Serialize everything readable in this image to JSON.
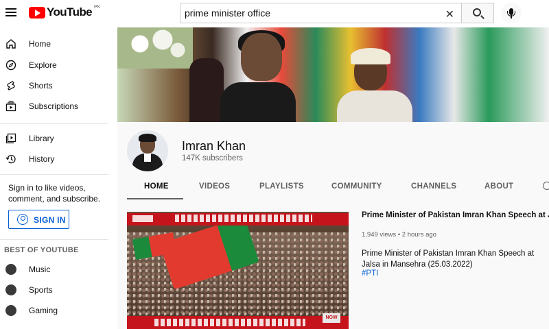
{
  "header": {
    "logo_text": "YouTube",
    "country_code": "PK",
    "search_value": "prime minister office",
    "search_placeholder": "Search"
  },
  "sidebar": {
    "items": [
      {
        "label": "Home",
        "icon": "home-icon"
      },
      {
        "label": "Explore",
        "icon": "compass-icon"
      },
      {
        "label": "Shorts",
        "icon": "shorts-icon"
      },
      {
        "label": "Subscriptions",
        "icon": "subscriptions-icon"
      },
      {
        "label": "Library",
        "icon": "library-icon"
      },
      {
        "label": "History",
        "icon": "history-icon"
      }
    ],
    "signin_prompt": "Sign in to like videos, comment, and subscribe.",
    "signin_label": "SIGN IN",
    "best_heading": "BEST OF YOUTUBE",
    "best_items": [
      {
        "label": "Music",
        "icon": "music-icon"
      },
      {
        "label": "Sports",
        "icon": "trophy-icon"
      },
      {
        "label": "Gaming",
        "icon": "gaming-icon"
      }
    ]
  },
  "channel": {
    "name": "Imran Khan",
    "subscribers": "147K subscribers",
    "tabs": [
      "HOME",
      "VIDEOS",
      "PLAYLISTS",
      "COMMUNITY",
      "CHANNELS",
      "ABOUT"
    ],
    "active_tab": "HOME"
  },
  "featured_video": {
    "title": "Prime Minister of Pakistan Imran Khan Speech at Jalsa in",
    "views": "1,949 views",
    "age": "2 hours ago",
    "description": "Prime Minister of Pakistan Imran Khan Speech at Jalsa in Mansehra (25.03.2022)",
    "hashtag": "#PTI",
    "thumb_badge": "NOW"
  },
  "colors": {
    "brand_red": "#ff0000",
    "link_blue": "#065fd4",
    "text_secondary": "#606060"
  }
}
